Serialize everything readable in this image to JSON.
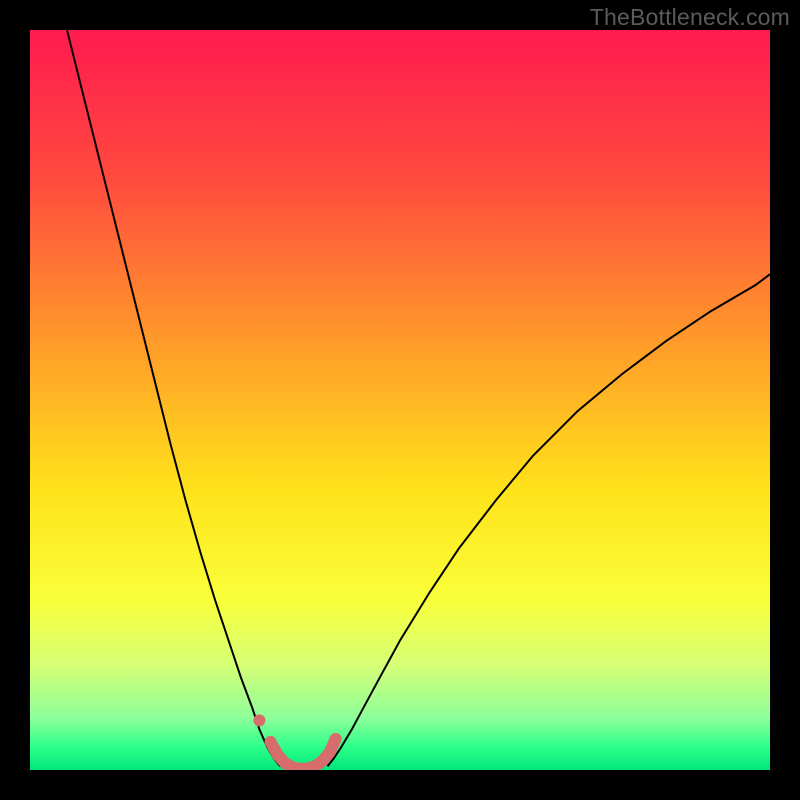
{
  "watermark": "TheBottleneck.com",
  "chart_data": {
    "type": "line",
    "title": "",
    "xlabel": "",
    "ylabel": "",
    "xlim": [
      0,
      100
    ],
    "ylim": [
      0,
      100
    ],
    "grid": false,
    "background_gradient": {
      "stops": [
        {
          "pos": 0.0,
          "color": "#ff1a4f"
        },
        {
          "pos": 0.2,
          "color": "#ff4a3e"
        },
        {
          "pos": 0.42,
          "color": "#ff9a2a"
        },
        {
          "pos": 0.62,
          "color": "#ffe21a"
        },
        {
          "pos": 0.77,
          "color": "#f9ff3a"
        },
        {
          "pos": 0.86,
          "color": "#d4ff77"
        },
        {
          "pos": 0.93,
          "color": "#8cff9a"
        },
        {
          "pos": 0.97,
          "color": "#2bff8a"
        },
        {
          "pos": 1.0,
          "color": "#00e77a"
        }
      ]
    },
    "series": [
      {
        "name": "left-curve",
        "stroke": "#000000",
        "stroke_width": 2,
        "x": [
          5,
          7,
          9,
          11,
          13,
          15,
          17,
          19,
          21,
          23,
          25,
          27,
          28.5,
          30,
          31,
          32,
          33,
          33.8
        ],
        "y": [
          100,
          92,
          84,
          76,
          68,
          60,
          52,
          44,
          36.5,
          29.5,
          23,
          17,
          12.5,
          8.5,
          5.5,
          3.2,
          1.5,
          0.5
        ]
      },
      {
        "name": "right-curve",
        "stroke": "#000000",
        "stroke_width": 2,
        "x": [
          40.2,
          41,
          42,
          43.5,
          45,
          47,
          50,
          54,
          58,
          63,
          68,
          74,
          80,
          86,
          92,
          98,
          100
        ],
        "y": [
          0.5,
          1.5,
          3.0,
          5.5,
          8.3,
          12,
          17.5,
          24,
          30,
          36.5,
          42.5,
          48.5,
          53.5,
          58,
          62,
          65.5,
          67
        ]
      },
      {
        "name": "highlight-U",
        "stroke": "#d66c6c",
        "stroke_width": 12,
        "linecap": "round",
        "x": [
          32.5,
          33.5,
          34.5,
          35.5,
          36.5,
          37.5,
          38.5,
          39.5,
          40.5,
          41.3
        ],
        "y": [
          3.8,
          2.0,
          0.9,
          0.35,
          0.15,
          0.2,
          0.5,
          1.2,
          2.4,
          4.2
        ]
      }
    ],
    "markers": [
      {
        "name": "highlight-dot",
        "x": 31.0,
        "y": 6.7,
        "r": 6,
        "fill": "#d66c6c"
      }
    ]
  }
}
